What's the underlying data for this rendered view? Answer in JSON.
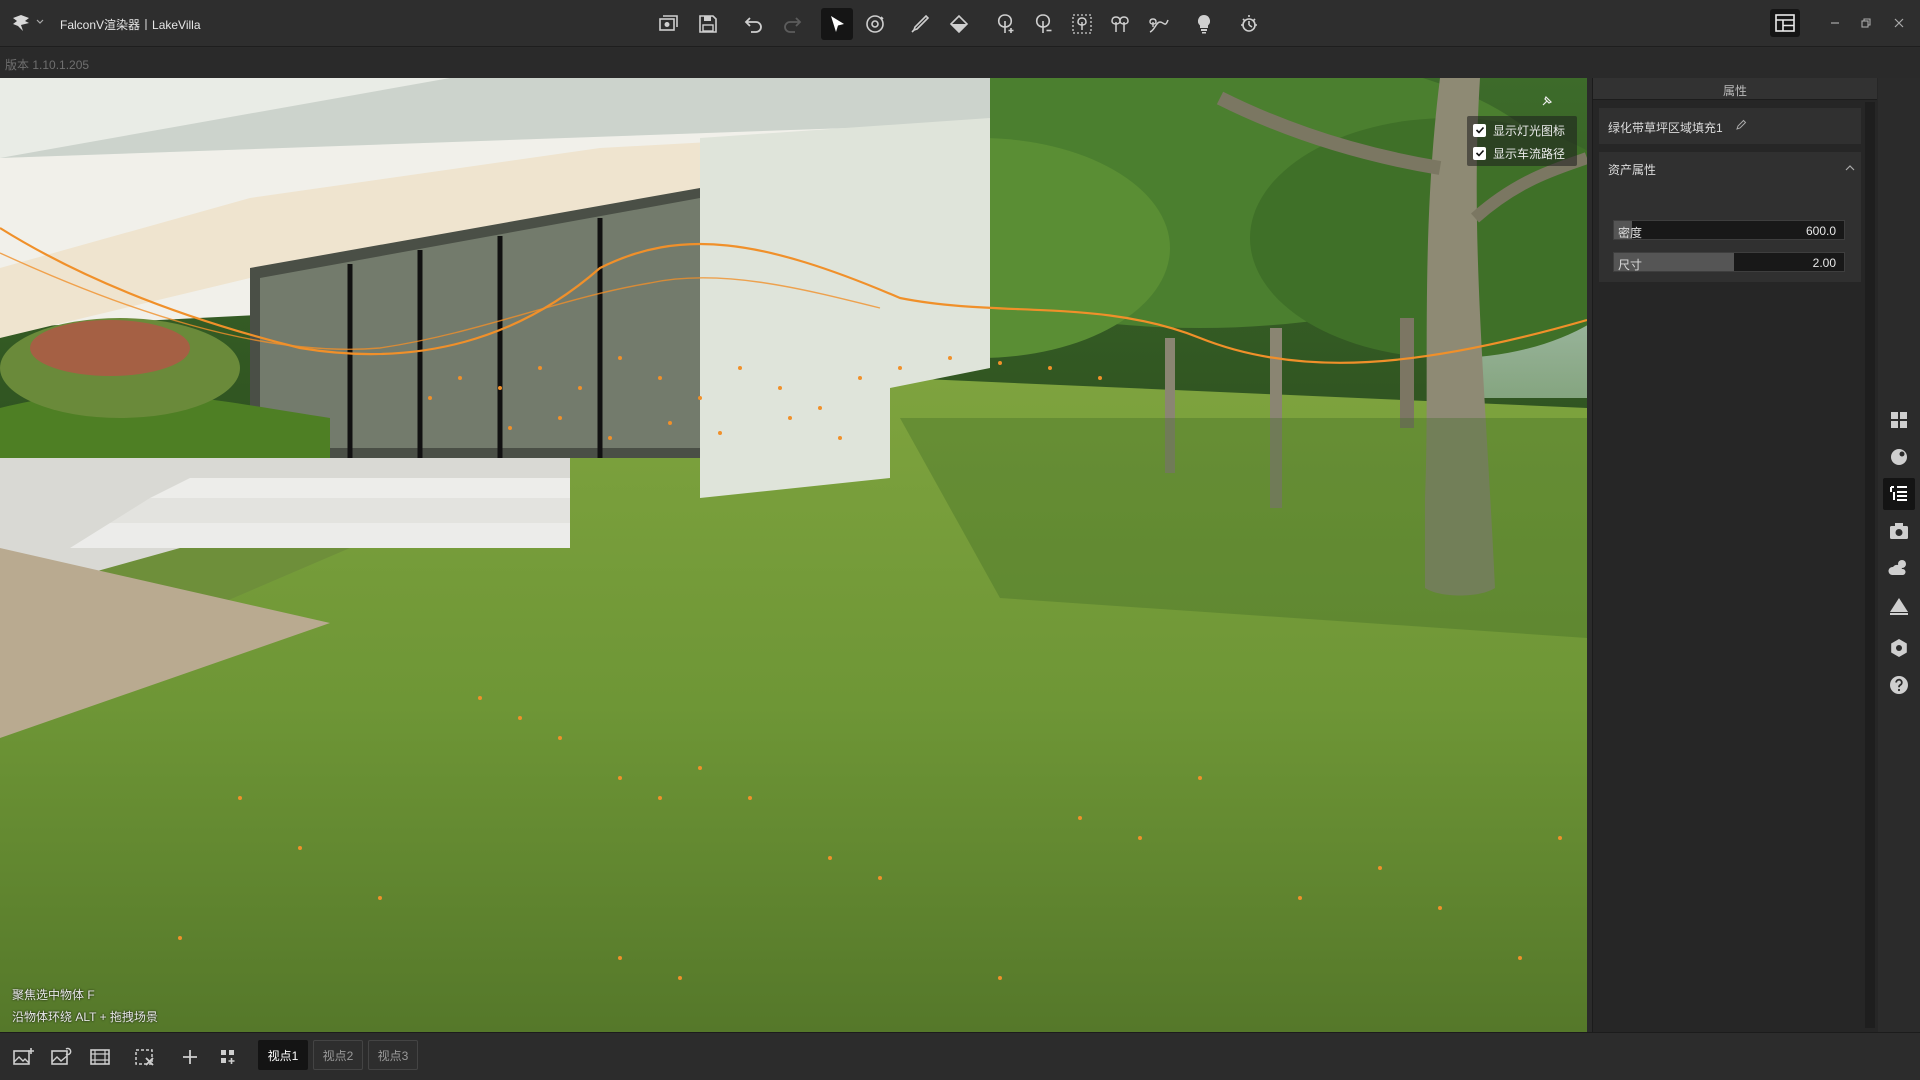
{
  "window": {
    "title": "FalconV渲染器丨LakeVilla",
    "version": "版本 1.10.1.205"
  },
  "toolbar": {
    "buttons": [
      {
        "name": "render-export-icon",
        "tooltip": ""
      },
      {
        "name": "save-icon",
        "tooltip": ""
      },
      {
        "name": "undo-icon",
        "tooltip": ""
      },
      {
        "name": "redo-icon",
        "tooltip": ""
      },
      {
        "name": "select-arrow-icon",
        "tooltip": ""
      },
      {
        "name": "orbit-icon",
        "tooltip": ""
      },
      {
        "name": "brush-icon",
        "tooltip": ""
      },
      {
        "name": "fill-bucket-icon",
        "tooltip": ""
      },
      {
        "name": "tree-plant-icon",
        "tooltip": ""
      },
      {
        "name": "tree-erase-icon",
        "tooltip": ""
      },
      {
        "name": "tree-area-icon",
        "tooltip": ""
      },
      {
        "name": "tree-row-icon",
        "tooltip": ""
      },
      {
        "name": "tree-path-icon",
        "tooltip": ""
      },
      {
        "name": "light-bulb-icon",
        "tooltip": ""
      },
      {
        "name": "sun-time-icon",
        "tooltip": ""
      }
    ]
  },
  "viewport": {
    "toggles": [
      {
        "label": "显示灯光图标",
        "checked": true
      },
      {
        "label": "显示车流路径",
        "checked": true
      }
    ],
    "hints": {
      "line1": "聚焦选中物体  F",
      "line2": "沿物体环绕    ALT + 拖拽场景"
    }
  },
  "panel": {
    "title": "属性",
    "object_name": "绿化带草坪区域填充1",
    "asset_section": "资产属性",
    "sliders": [
      {
        "label": "密度",
        "value": "600.0",
        "fill": 0.08
      },
      {
        "label": "尺寸",
        "value": "2.00",
        "fill": 0.52
      }
    ]
  },
  "sidebar": {
    "items": [
      {
        "name": "assets-grid-icon",
        "active": false
      },
      {
        "name": "material-ball-icon",
        "active": false
      },
      {
        "name": "scene-list-icon",
        "active": true
      },
      {
        "name": "camera-icon",
        "active": false
      },
      {
        "name": "weather-icon",
        "active": false
      },
      {
        "name": "terrain-icon",
        "active": false
      },
      {
        "name": "settings-icon",
        "active": false
      },
      {
        "name": "help-icon",
        "active": false
      }
    ]
  },
  "bottombar": {
    "viewpoints": [
      "视点1",
      "视点2",
      "视点3"
    ],
    "active_viewpoint": "视点1"
  },
  "colors": {
    "accent_orange": "#f0902a",
    "panel_bg": "#262626",
    "toolbar_bg": "#2e2e2e",
    "active_bg": "#151515"
  }
}
